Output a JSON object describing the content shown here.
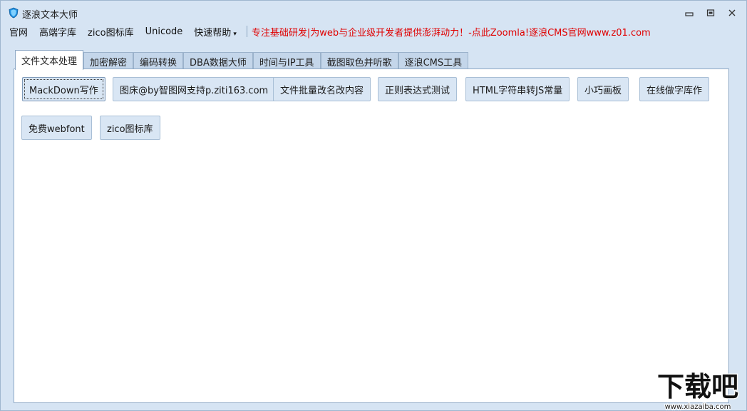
{
  "window": {
    "title": "逐浪文本大师",
    "controls": {
      "minimize": "▭",
      "maximize": "□",
      "close": "✕"
    }
  },
  "menu": {
    "items": [
      "官网",
      "高端字库",
      "zico图标库",
      "Unicode",
      "快速帮助"
    ],
    "dropdown_caret": "▾",
    "promo": "专注基础研发|为web与企业级开发者提供澎湃动力！-点此Zoomla!逐浪CMS官网www.z01.com"
  },
  "tabs": [
    "文件文本处理",
    "加密解密",
    "编码转换",
    "DBA数据大师",
    "时间与IP工具",
    "截图取色并听歌",
    "逐浪CMS工具"
  ],
  "buttons": {
    "row1": [
      "MackDown写作",
      "图床@by智图网支持p.ziti163.com",
      "文件批量改名改内容",
      "正则表达式测试",
      "HTML字符串转JS常量",
      "小巧画板",
      "在线做字库作"
    ],
    "row2": [
      "免费webfont",
      "zico图标库"
    ]
  },
  "watermark": {
    "main": "下载吧",
    "url": "www.xiazaiba.com"
  },
  "colors": {
    "promo": "#e00000",
    "window_bg": "#d6e4f3",
    "button_bg": "#d9e6f4",
    "app_icon": "#1f8fe0"
  }
}
